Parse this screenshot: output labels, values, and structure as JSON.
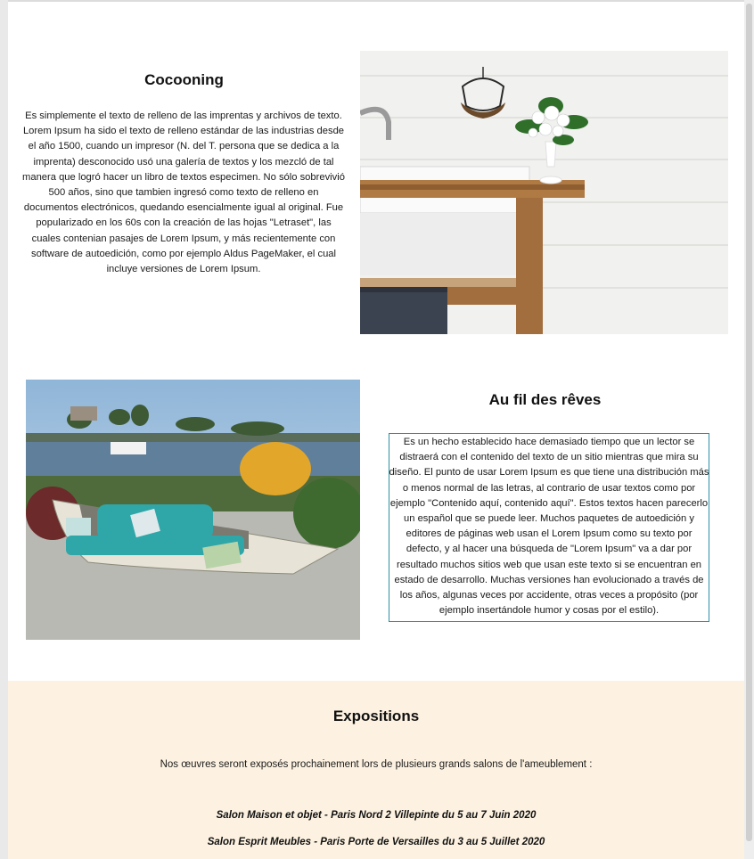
{
  "cocooning": {
    "title": "Cocooning",
    "text": "Es simplemente el texto de relleno de las imprentas y archivos de texto. Lorem Ipsum ha sido el texto de relleno estándar de las industrias desde el año 1500, cuando un impresor (N. del T. persona que se dedica a la imprenta) desconocido usó una galería de textos y los mezcló de tal manera que logró hacer un libro de textos especimen. No sólo sobrevivió 500 años, sino que tambien ingresó como texto de relleno en documentos electrónicos, quedando esencialmente igual al original. Fue popularizado en los 60s con la creación de las hojas \"Letraset\", las cuales contenian pasajes de Lorem Ipsum, y más recientemente con software de autoedición, como por ejemplo Aldus PageMaker, el cual incluye versiones de Lorem Ipsum."
  },
  "reves": {
    "title": "Au fil des rêves",
    "text": "Es un hecho establecido hace demasiado tiempo que un lector se distraerá con el contenido del texto de un sitio mientras que mira su diseño. El punto de usar Lorem Ipsum es que tiene una distribución más o menos normal de las letras, al contrario de usar textos como por ejemplo \"Contenido aquí, contenido aquí\". Estos textos hacen parecerlo un español que se puede leer. Muchos paquetes de autoedición y editores de páginas web usan el Lorem Ipsum como su texto por defecto, y al hacer una búsqueda de \"Lorem Ipsum\" va a dar por resultado muchos sitios web que usan este texto si se encuentran en estado de desarrollo. Muchas versiones han evolucionado a través de los años, algunas veces por accidente, otras veces a propósito (por ejemplo insertándole humor y cosas por el estilo)."
  },
  "expositions": {
    "title": "Expositions",
    "intro": "Nos œuvres seront exposés prochainement lors de plusieurs grands salons de l'ameublement :",
    "salons": [
      "Salon Maison et objet - Paris Nord 2 Villepinte du 5 au 7 Juin 2020",
      "Salon Esprit Meubles - Paris Porte de Versailles du 3 au 5 Juillet 2020"
    ]
  },
  "colors": {
    "expo_background": "#fdf2e1",
    "textbox_border": "#2a8fa6"
  }
}
